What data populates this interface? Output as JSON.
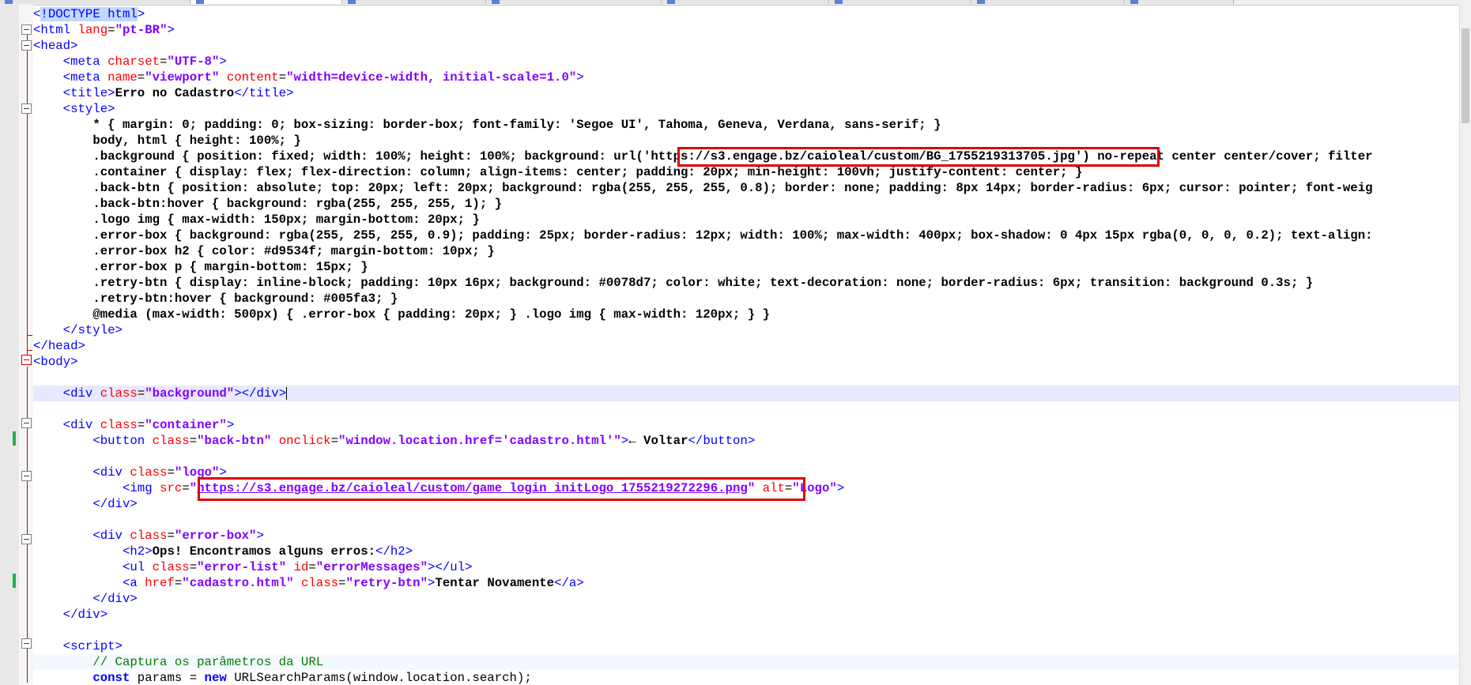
{
  "tabs": [
    {
      "label": ""
    },
    {
      "label": ""
    },
    {
      "label": ""
    },
    {
      "label": ""
    },
    {
      "label": ""
    },
    {
      "label": ""
    },
    {
      "label": ""
    },
    {
      "label": ""
    }
  ],
  "code": {
    "l1": "!DOCTYPE html",
    "l2_lang": "pt-BR",
    "l4_charset": "UTF-8",
    "l5_name": "viewport",
    "l5_content": "width=device-width, initial-scale=1.0",
    "l6_title": "Erro no Cadastro",
    "css1": "* { margin: 0; padding: 0; box-sizing: border-box; font-family: 'Segoe UI', Tahoma, Geneva, Verdana, sans-serif; }",
    "css2": "body, html { height: 100%; }",
    "css3_pre": ".background { position: fixed; width: 100%; height: 100%; background: url",
    "css3_url": "('https://s3.engage.bz/caioleal/custom/BG_1755219313705.jpg')",
    "css3_post": " no-repeat center center/cover; filter",
    "css4": ".container { display: flex; flex-direction: column; align-items: center; padding: 20px; min-height: 100vh; justify-content: center; }",
    "css5": ".back-btn { position: absolute; top: 20px; left: 20px; background: rgba(255, 255, 255, 0.8); border: none; padding: 8px 14px; border-radius: 6px; cursor: pointer; font-weig",
    "css6": ".back-btn:hover { background: rgba(255, 255, 255, 1); }",
    "css7": ".logo img { max-width: 150px; margin-bottom: 20px; }",
    "css8": ".error-box { background: rgba(255, 255, 255, 0.9); padding: 25px; border-radius: 12px; width: 100%; max-width: 400px; box-shadow: 0 4px 15px rgba(0, 0, 0, 0.2); text-align:",
    "css9": ".error-box h2 { color: #d9534f; margin-bottom: 10px; }",
    "css10": ".error-box p { margin-bottom: 15px; }",
    "css11": ".retry-btn { display: inline-block; padding: 10px 16px; background: #0078d7; color: white; text-decoration: none; border-radius: 6px; transition: background 0.3s; }",
    "css12": ".retry-btn:hover { background: #005fa3; }",
    "css13": "@media (max-width: 500px) { .error-box { padding: 20px; } .logo img { max-width: 120px; } }",
    "div_bg_class": "background",
    "div_container_class": "container",
    "btn_class": "back-btn",
    "btn_onclick": "window.location.href='cadastro.html'",
    "btn_text": "← Voltar",
    "div_logo_class": "logo",
    "img_src": "https://s3.engage.bz/caioleal/custom/game_login_initLogo_1755219272296.png",
    "img_alt": "Logo",
    "div_error_class": "error-box",
    "h2_text": "Ops! Encontramos alguns erros:",
    "ul_class": "error-list",
    "ul_id": "errorMessages",
    "a_href": "cadastro.html",
    "a_class": "retry-btn",
    "a_text": "Tentar Novamente",
    "comment": "// Captura os parâmetros da URL",
    "last_kw1": "const",
    "last_mid": " params = ",
    "last_kw2": "new",
    "last_post": " URLSearchParams(window.location.search);"
  }
}
